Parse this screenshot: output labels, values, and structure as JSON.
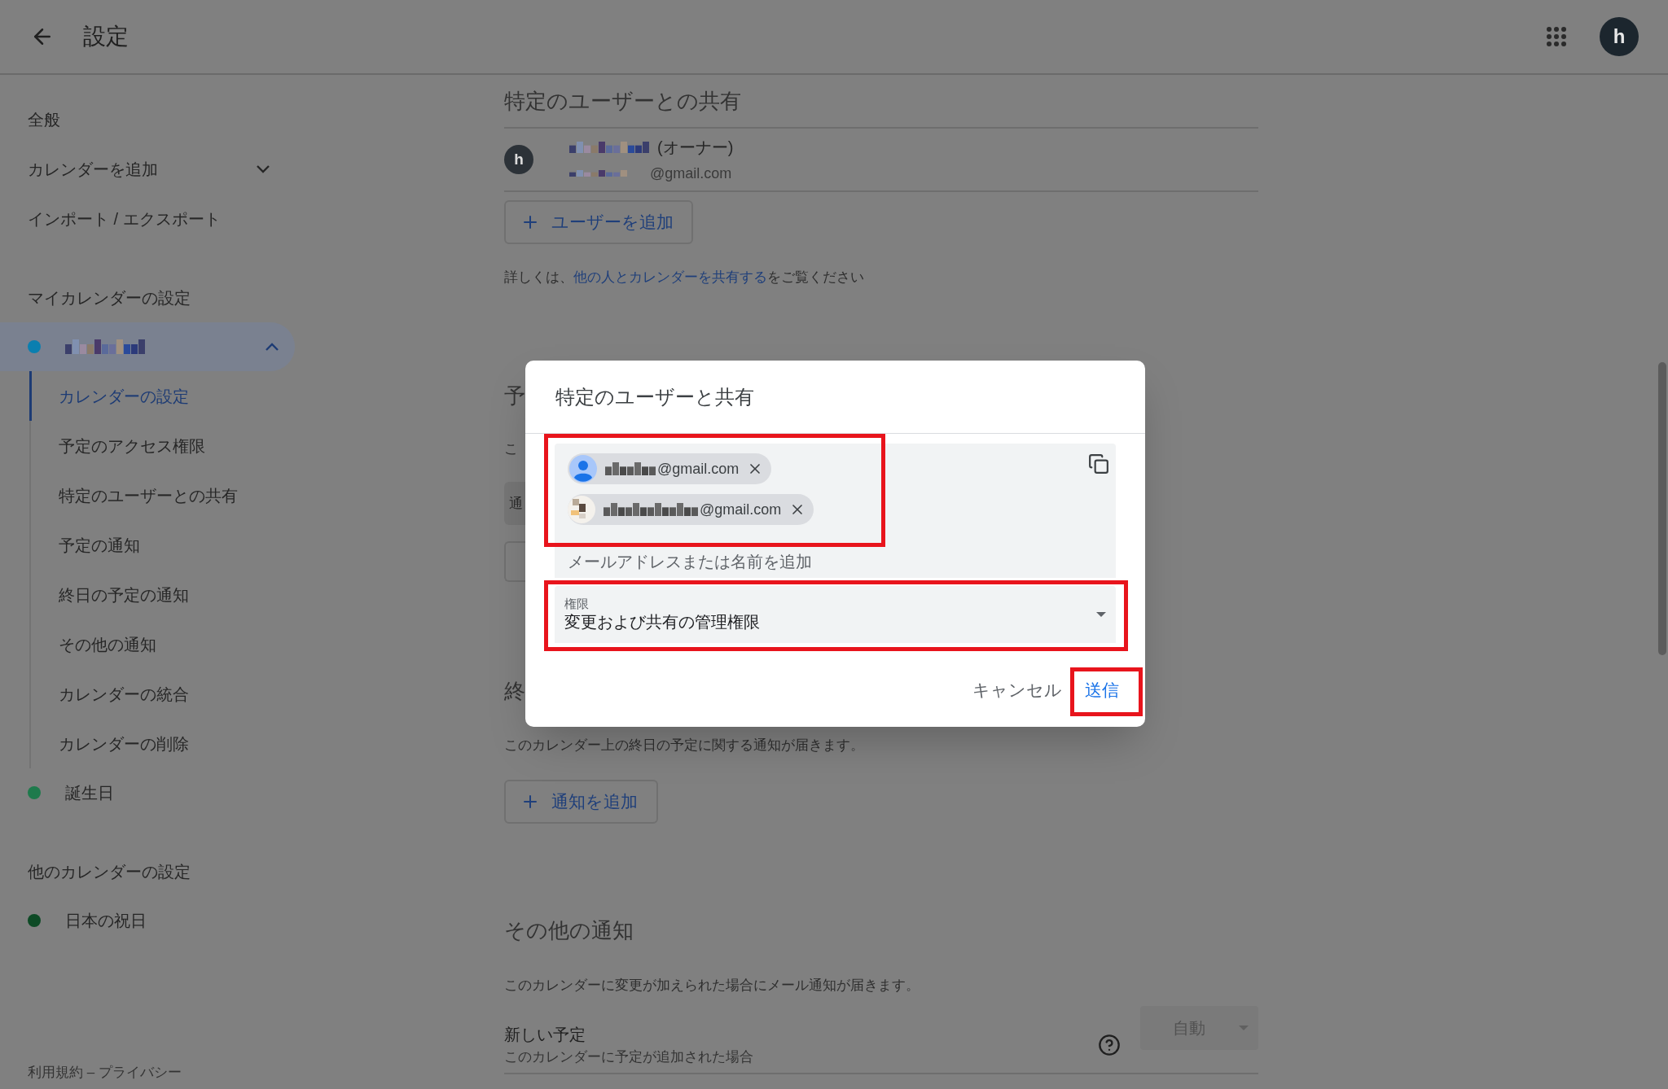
{
  "header": {
    "title": "設定",
    "avatar": "h"
  },
  "sidebar": {
    "items": [
      {
        "label": "全般",
        "kind": "link"
      },
      {
        "label": "カレンダーを追加",
        "kind": "expandable",
        "expanded": false
      },
      {
        "label": "インポート / エクスポート",
        "kind": "link"
      }
    ],
    "sections": [
      {
        "heading": "マイカレンダーの設定",
        "calendars": [
          {
            "kind": "redacted",
            "color": "#0a7fb0",
            "expanded": true,
            "selected": true,
            "children": [
              {
                "label": "カレンダーの設定",
                "selected": true
              },
              {
                "label": "予定のアクセス権限",
                "selected": false
              },
              {
                "label": "特定のユーザーとの共有",
                "selected": false
              },
              {
                "label": "予定の通知",
                "selected": false
              },
              {
                "label": "終日の予定の通知",
                "selected": false
              },
              {
                "label": "その他の通知",
                "selected": false
              },
              {
                "label": "カレンダーの統合",
                "selected": false
              },
              {
                "label": "カレンダーの削除",
                "selected": false
              }
            ]
          },
          {
            "kind": "named",
            "label": "誕生日",
            "color": "#1e7a4c",
            "selected": false
          }
        ]
      },
      {
        "heading": "他のカレンダーの設定",
        "calendars": [
          {
            "kind": "named",
            "label": "日本の祝日",
            "color": "#0d4a25",
            "selected": false
          }
        ]
      }
    ],
    "footer": "利用規約 – プライバシー"
  },
  "sharing": {
    "heading": "特定のユーザーとの共有",
    "users": [
      {
        "avatar": "h",
        "role": "(オーナー)",
        "email": "@gmail.com"
      }
    ],
    "add_button": "ユーザーを追加",
    "help_before": "詳しくは、",
    "help_link": "他の人とカレンダーを共有する",
    "help_after": "をご覧ください"
  },
  "event_access": {
    "heading": "予",
    "description": "こ",
    "select": "通"
  },
  "all_day": {
    "heading": "終",
    "description": "このカレンダー上の終日の予定に関する通知が届きます。",
    "add_button": "通知を追加"
  },
  "other": {
    "heading": "その他の通知",
    "description": "このカレンダーに変更が加えられた場合にメール通知が届きます。",
    "rows": [
      {
        "title": "新しい予定",
        "subtitle": "このカレンダーに予定が追加された場合",
        "value": "自動",
        "disabled": true
      }
    ]
  },
  "dialog": {
    "title": "特定のユーザーと共有",
    "chips": [
      {
        "kind": "default_avatar",
        "email": "@gmail.com"
      },
      {
        "kind": "photo_avatar",
        "email": "@gmail.com"
      }
    ],
    "placeholder": "メールアドレスまたは名前を追加",
    "permission": {
      "label": "権限",
      "value": "変更および共有の管理権限"
    },
    "buttons": [
      {
        "label": "キャンセル",
        "kind": "text"
      },
      {
        "label": "送信",
        "kind": "primary"
      }
    ]
  }
}
